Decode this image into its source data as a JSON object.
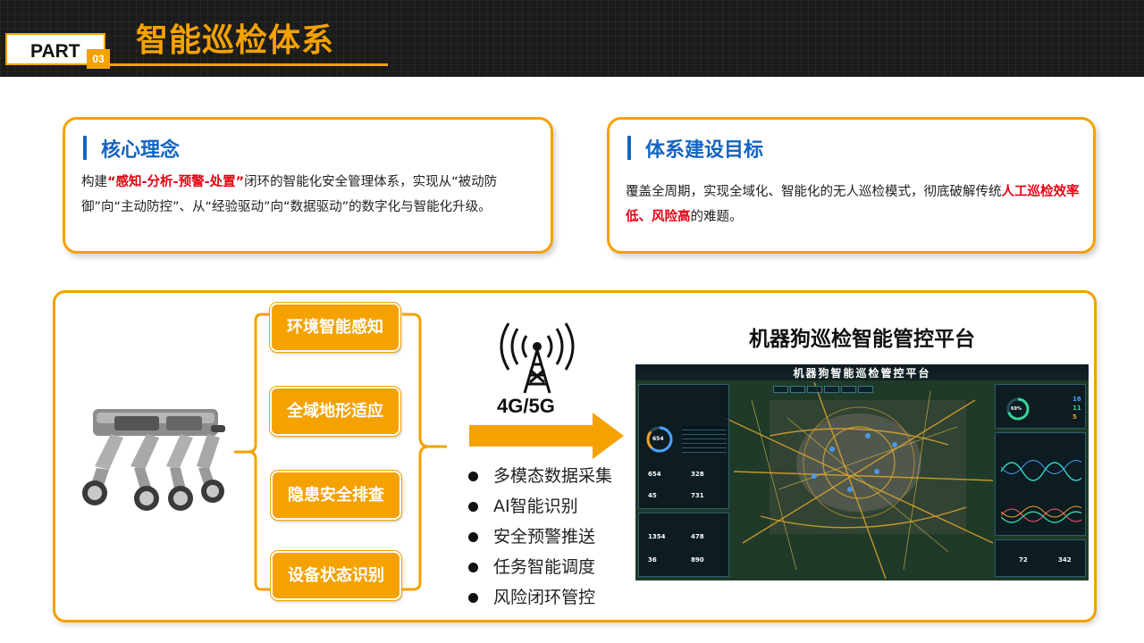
{
  "header": {
    "part_label": "PART",
    "part_number": "03",
    "title": "智能巡检体系"
  },
  "card_core": {
    "title": "核心理念",
    "text_pre": "构建",
    "text_highlight": "“感知-分析-预警-处置”",
    "text_post": "闭环的智能化安全管理体系，实现从“被动防御”向“主动防控”、从“经验驱动”向“数据驱动”的数字化与智能化升级。"
  },
  "card_goal": {
    "title": "体系建设目标",
    "text_pre": "覆盖全周期，实现全域化、智能化的无人巡检模式，彻底破解传统",
    "text_highlight": "人工巡检效率低、风险高",
    "text_post": "的难题。"
  },
  "features": [
    {
      "label": "环境智能感知"
    },
    {
      "label": "全域地形适应"
    },
    {
      "label": "隐患安全排查"
    },
    {
      "label": "设备状态识别"
    }
  ],
  "network": {
    "label": "4G/5G"
  },
  "capabilities": [
    "多模态数据采集",
    "AI智能识别",
    "安全预警推送",
    "任务智能调度",
    "风险闭环管控"
  ],
  "platform": {
    "title": "机器狗巡检智能管控平台",
    "screen_title": "机器狗智能巡检管控平台",
    "stats": [
      "654",
      "328",
      "45",
      "731",
      "1354",
      "478",
      "36",
      "890",
      "72",
      "342"
    ],
    "ring_left": "654",
    "ring_right": "69%",
    "right_numbers": [
      "16",
      "11",
      "5"
    ]
  },
  "colors": {
    "accent": "#f5a100",
    "header_bg": "#1b1b1b",
    "title_blue": "#1565c0",
    "highlight_red": "#e60012"
  }
}
